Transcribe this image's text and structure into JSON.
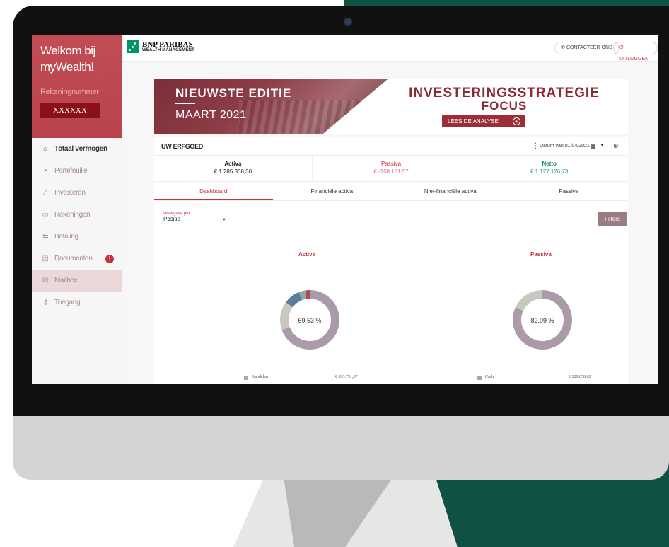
{
  "sidebar": {
    "welcome_line1": "Welkom bij",
    "welcome_line2": "myWealth!",
    "account_label": "Rekeningnummer",
    "account_value": "XXXXXX",
    "items": [
      {
        "label": "Totaal vermogen",
        "icon": "bank-icon"
      },
      {
        "label": "Portefeuille",
        "icon": "pie-chart-icon"
      },
      {
        "label": "Investeren",
        "icon": "line-chart-icon"
      },
      {
        "label": "Rekeningen",
        "icon": "wallet-icon"
      },
      {
        "label": "Betaling",
        "icon": "transfer-icon"
      },
      {
        "label": "Documenten",
        "icon": "document-icon",
        "badge": "!"
      },
      {
        "label": "Mailbox",
        "icon": "mail-icon"
      },
      {
        "label": "Toegang",
        "icon": "key-icon"
      }
    ]
  },
  "topbar": {
    "brand_line1": "BNP PARIBAS",
    "brand_line2": "WEALTH MANAGEMENT",
    "contact_label": "CONTACTEER ONS",
    "logout_label": "UITLOGGEN"
  },
  "banner": {
    "left_title": "NIEUWSTE EDITIE",
    "left_subtitle": "MAART 2021",
    "right_title": "INVESTERINGSSTRATEGIE",
    "right_subtitle": "FOCUS",
    "button_label": "LEES DE ANALYSE"
  },
  "card": {
    "title": "UW ERFGOED",
    "date_label": "Datum van 01/04/2021"
  },
  "summary": {
    "activa_label": "Activa",
    "activa_value": "€ 1.285.308,30",
    "passiva_label": "Passiva",
    "passiva_value": "€ -158.181,57",
    "netto_label": "Netto",
    "netto_value": "€ 1.127.126,73"
  },
  "tabs": [
    "Dashboard",
    "Financiële activa",
    "Niet-financiële activa",
    "Passiva"
  ],
  "filter": {
    "select_label": "Weergave per",
    "select_value": "Positie",
    "filters_button": "Filters"
  },
  "colors": {
    "brand_red": "#c4323c",
    "sidebar_header": "#b8434c",
    "donut_main": "#ab9aaa",
    "donut_secondary": "#c7c9bf",
    "donut_blue": "#5b7d9c",
    "donut_teal": "#8fa8a4",
    "donut_red": "#b3484f"
  },
  "chart_data": [
    {
      "type": "pie",
      "title": "Activa",
      "center_label": "69,53 %",
      "slices": [
        {
          "value": 69.53,
          "color": "#ab9aaa"
        },
        {
          "value": 15.5,
          "color": "#c7c9bf"
        },
        {
          "value": 9.0,
          "color": "#5b7d9c"
        },
        {
          "value": 3.5,
          "color": "#8fa8a4"
        },
        {
          "value": 2.47,
          "color": "#b3484f"
        }
      ],
      "legend": [
        {
          "name": "Aandelen",
          "value": "€ 893.731,37"
        }
      ]
    },
    {
      "type": "pie",
      "title": "Passiva",
      "center_label": "82,09 %",
      "slices": [
        {
          "value": 82.09,
          "color": "#ab9aaa"
        },
        {
          "value": 17.91,
          "color": "#c7c9bf"
        }
      ],
      "legend": [
        {
          "name": "Cash",
          "value": "€ 129.858,82"
        }
      ]
    }
  ]
}
